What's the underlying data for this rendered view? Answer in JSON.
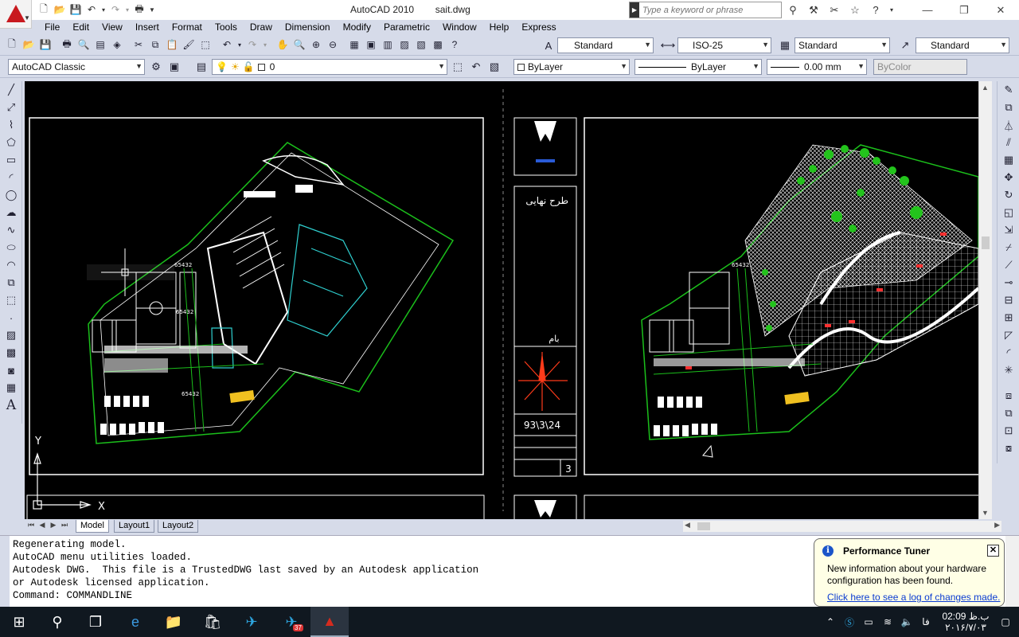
{
  "window": {
    "app_title": "AutoCAD 2010",
    "file_title": "sait.dwg",
    "search_placeholder": "Type a keyword or phrase"
  },
  "menu": [
    "File",
    "Edit",
    "View",
    "Insert",
    "Format",
    "Tools",
    "Draw",
    "Dimension",
    "Modify",
    "Parametric",
    "Window",
    "Help",
    "Express"
  ],
  "styles_toolbar": {
    "text_style": "Standard",
    "dim_style": "ISO-25",
    "table_style": "Standard",
    "mleader_style": "Standard"
  },
  "workspace": "AutoCAD Classic",
  "layers_toolbar": {
    "current_layer": "0",
    "color": "ByLayer",
    "linetype": "ByLayer",
    "lineweight": "0.00 mm",
    "plot_style": "ByColor"
  },
  "drawing": {
    "title_block": {
      "project_name": "طرح نهایی",
      "roof_label": "بام",
      "date": "93\\3\\24",
      "sheet_number": "3"
    },
    "ucs": {
      "x_label": "X",
      "y_label": "Y"
    },
    "dim_labels": [
      "65432",
      "65432",
      "65432",
      "65432"
    ]
  },
  "tabs": {
    "model": "Model",
    "layout1": "Layout1",
    "layout2": "Layout2"
  },
  "command_window": {
    "lines": [
      "Regenerating model.",
      "AutoCAD menu utilities loaded.",
      "Autodesk DWG.  This file is a TrustedDWG last saved by an Autodesk application",
      "or Autodesk licensed application.",
      "Command: COMMANDLINE"
    ]
  },
  "balloon": {
    "title": "Performance Tuner",
    "message": "New information about your hardware configuration has been found.",
    "link": "Click here to see a log of changes made."
  },
  "taskbar": {
    "telegram_badge": "37",
    "lang": "فا",
    "time": "02:09 ب.ظ",
    "date": "۲۰۱۶/۷/۰۳"
  }
}
